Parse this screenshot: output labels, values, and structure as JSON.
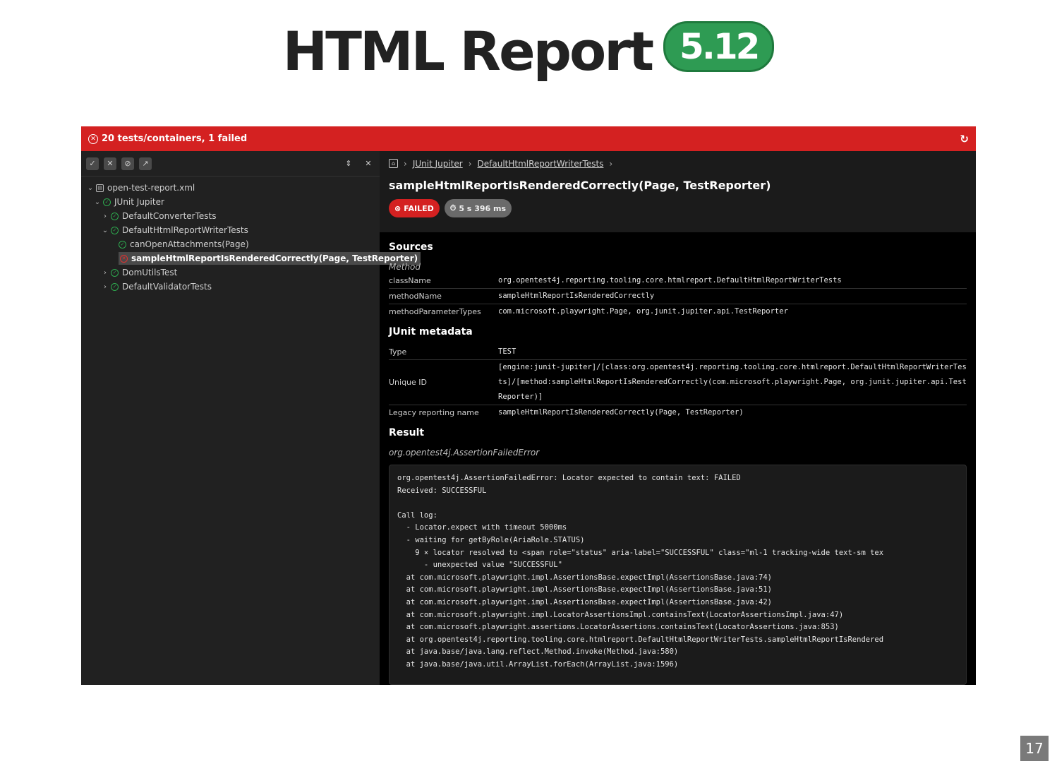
{
  "slide": {
    "title": "HTML Report",
    "version": "5.12",
    "page_number": "17"
  },
  "status_bar": {
    "text": "20 tests/containers, 1 failed"
  },
  "sidebar": {
    "tree": [
      {
        "label": "open-test-report.xml",
        "depth": 0,
        "expanded": true,
        "icon": "file-icon"
      },
      {
        "label": "JUnit Jupiter",
        "depth": 1,
        "expanded": true,
        "icon": "success-icon"
      },
      {
        "label": "DefaultConverterTests",
        "depth": 2,
        "expanded": false,
        "icon": "success-icon"
      },
      {
        "label": "DefaultHtmlReportWriterTests",
        "depth": 2,
        "expanded": true,
        "icon": "success-icon"
      },
      {
        "label": "canOpenAttachments(Page)",
        "depth": 3,
        "icon": "success-icon"
      },
      {
        "label": "sampleHtmlReportIsRenderedCorrectly(Page, TestReporter)",
        "depth": 3,
        "icon": "failed-icon",
        "selected": true
      },
      {
        "label": "DomUtilsTest",
        "depth": 2,
        "expanded": false,
        "icon": "success-icon"
      },
      {
        "label": "DefaultValidatorTests",
        "depth": 2,
        "expanded": false,
        "icon": "success-icon"
      }
    ]
  },
  "main": {
    "breadcrumb": [
      "JUnit Jupiter",
      "DefaultHtmlReportWriterTests"
    ],
    "test_title": "sampleHtmlReportIsRenderedCorrectly(Page, TestReporter)",
    "status_badge": "FAILED",
    "duration_badge": "5 s 396 ms",
    "sources": {
      "title": "Sources",
      "subtitle": "Method",
      "rows": [
        {
          "key": "className",
          "value": "org.opentest4j.reporting.tooling.core.htmlreport.DefaultHtmlReportWriterTests"
        },
        {
          "key": "methodName",
          "value": "sampleHtmlReportIsRenderedCorrectly"
        },
        {
          "key": "methodParameterTypes",
          "value": "com.microsoft.playwright.Page, org.junit.jupiter.api.TestReporter"
        }
      ]
    },
    "junit_metadata": {
      "title": "JUnit metadata",
      "rows": [
        {
          "key": "Type",
          "value": "TEST"
        },
        {
          "key": "Unique ID",
          "value": "[engine:junit-jupiter]/[class:org.opentest4j.reporting.tooling.core.htmlreport.DefaultHtmlReportWriterTests]/[method:sampleHtmlReportIsRenderedCorrectly(com.microsoft.playwright.Page, org.junit.jupiter.api.TestReporter)]"
        },
        {
          "key": "Legacy reporting name",
          "value": "sampleHtmlReportIsRenderedCorrectly(Page, TestReporter)"
        }
      ]
    },
    "result": {
      "title": "Result",
      "exception_type": "org.opentest4j.AssertionFailedError",
      "log": "org.opentest4j.AssertionFailedError: Locator expected to contain text: FAILED\nReceived: SUCCESSFUL\n\nCall log:\n  - Locator.expect with timeout 5000ms\n  - waiting for getByRole(AriaRole.STATUS)\n    9 × locator resolved to <span role=\"status\" aria-label=\"SUCCESSFUL\" class=\"ml-1 tracking-wide text-sm tex\n      - unexpected value \"SUCCESSFUL\"\n  at com.microsoft.playwright.impl.AssertionsBase.expectImpl(AssertionsBase.java:74)\n  at com.microsoft.playwright.impl.AssertionsBase.expectImpl(AssertionsBase.java:51)\n  at com.microsoft.playwright.impl.AssertionsBase.expectImpl(AssertionsBase.java:42)\n  at com.microsoft.playwright.impl.LocatorAssertionsImpl.containsText(LocatorAssertionsImpl.java:47)\n  at com.microsoft.playwright.assertions.LocatorAssertions.containsText(LocatorAssertions.java:853)\n  at org.opentest4j.reporting.tooling.core.htmlreport.DefaultHtmlReportWriterTests.sampleHtmlReportIsRendered\n  at java.base/java.lang.reflect.Method.invoke(Method.java:580)\n  at java.base/java.util.ArrayList.forEach(ArrayList.java:1596)"
    }
  },
  "colors": {
    "status_failed": "#d42121",
    "success": "#2eaa4f",
    "version_badge": "#2e9b53"
  }
}
